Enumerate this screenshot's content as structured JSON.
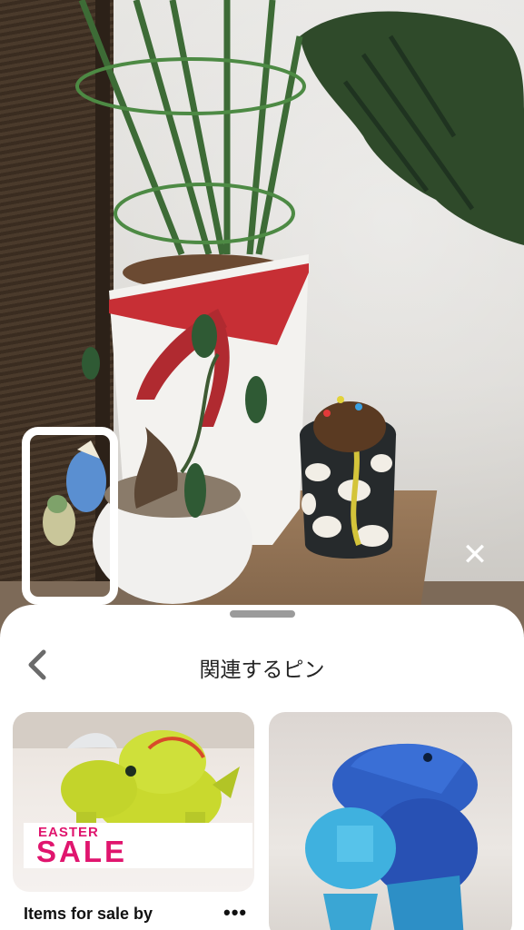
{
  "photo": {
    "close_label": "✕"
  },
  "sheet": {
    "title": "関連するピン",
    "back_label": "‹"
  },
  "pins": [
    {
      "banner_small": "EASTER",
      "banner_big": "SALE",
      "caption": "Items for sale by",
      "more_label": "•••"
    },
    {}
  ],
  "colors": {
    "accent_pink": "#e0156e",
    "sheet_bg": "#ffffff",
    "handle": "#9b9b9b"
  },
  "icons": [
    "close-icon",
    "chevron-left-icon",
    "more-dots-icon"
  ]
}
